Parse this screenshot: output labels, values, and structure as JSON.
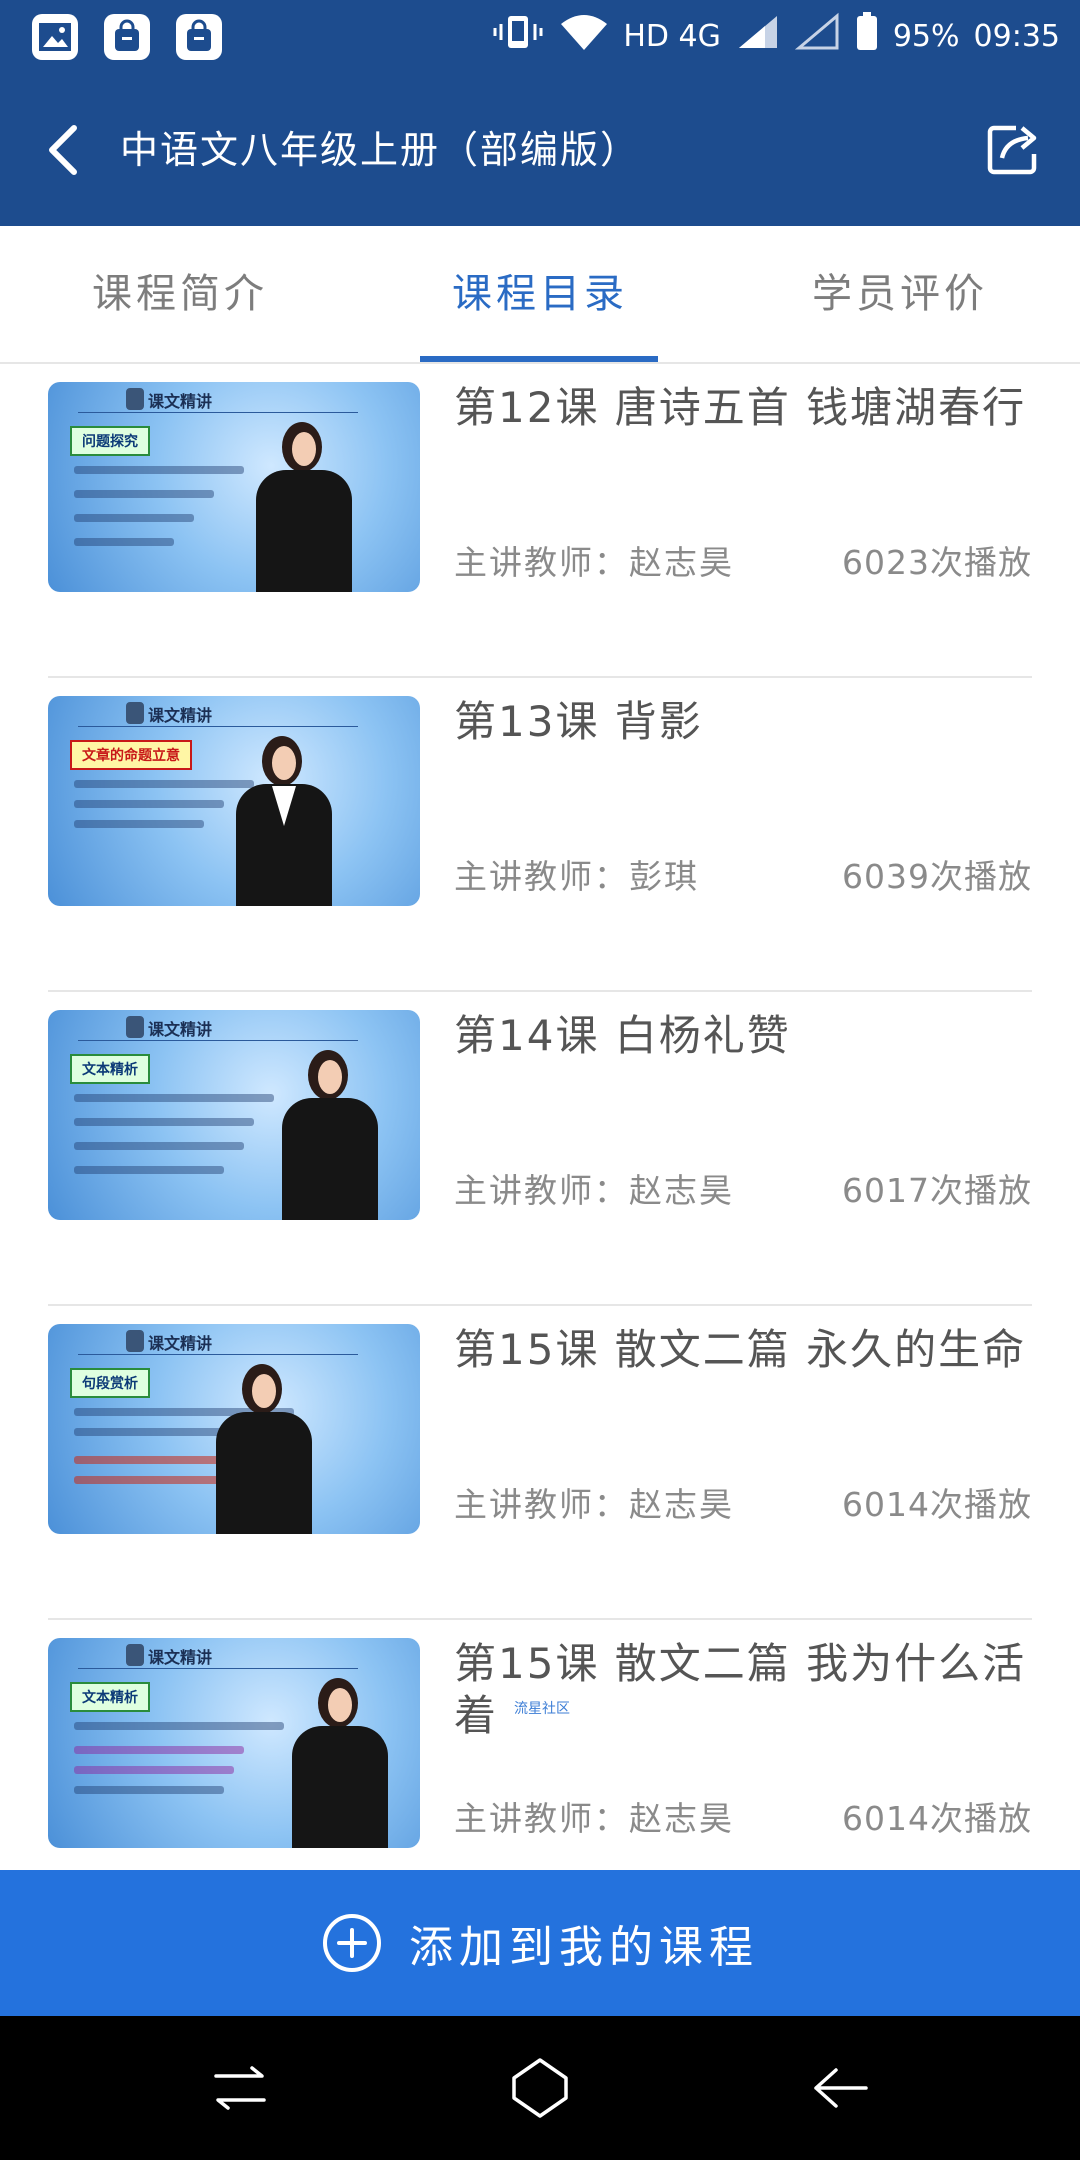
{
  "status_bar": {
    "network": "HD 4G",
    "battery": "95%",
    "time": "09:35",
    "background": "#1d4c8e"
  },
  "header": {
    "title": "中语文八年级上册（部编版）",
    "background": "#1d4c8e",
    "back_icon": "chevron-left-icon",
    "share_icon": "share-icon"
  },
  "tabs": [
    {
      "label": "课程简介",
      "active": false
    },
    {
      "label": "课程目录",
      "active": true
    },
    {
      "label": "学员评价",
      "active": false
    }
  ],
  "accent_color": "#2a6bc4",
  "thumbnail": {
    "caption": "课文精讲"
  },
  "lessons": [
    {
      "title": "第12课 唐诗五首 钱塘湖春行",
      "teacher": "主讲教师：赵志昊",
      "plays": "6023次播放",
      "tag": "问题探究"
    },
    {
      "title": "第13课 背影",
      "teacher": "主讲教师：彭琪",
      "plays": "6039次播放",
      "tag": "文章的命题立意"
    },
    {
      "title": "第14课 白杨礼赞",
      "teacher": "主讲教师：赵志昊",
      "plays": "6017次播放",
      "tag": "文本精析"
    },
    {
      "title": "第15课 散文二篇 永久的生命",
      "teacher": "主讲教师：赵志昊",
      "plays": "6014次播放",
      "tag": "句段赏析"
    },
    {
      "title": "第15课 散文二篇 我为什么活着",
      "teacher": "主讲教师：赵志昊",
      "plays": "6014次播放",
      "tag": "文本精析"
    }
  ],
  "watermark": "流星社区",
  "add_button": {
    "label": "添加到我的课程",
    "background": "#2472dd",
    "icon": "plus-circle-icon"
  },
  "nav": {
    "icons": [
      "recent-apps-icon",
      "home-icon",
      "back-icon"
    ]
  }
}
